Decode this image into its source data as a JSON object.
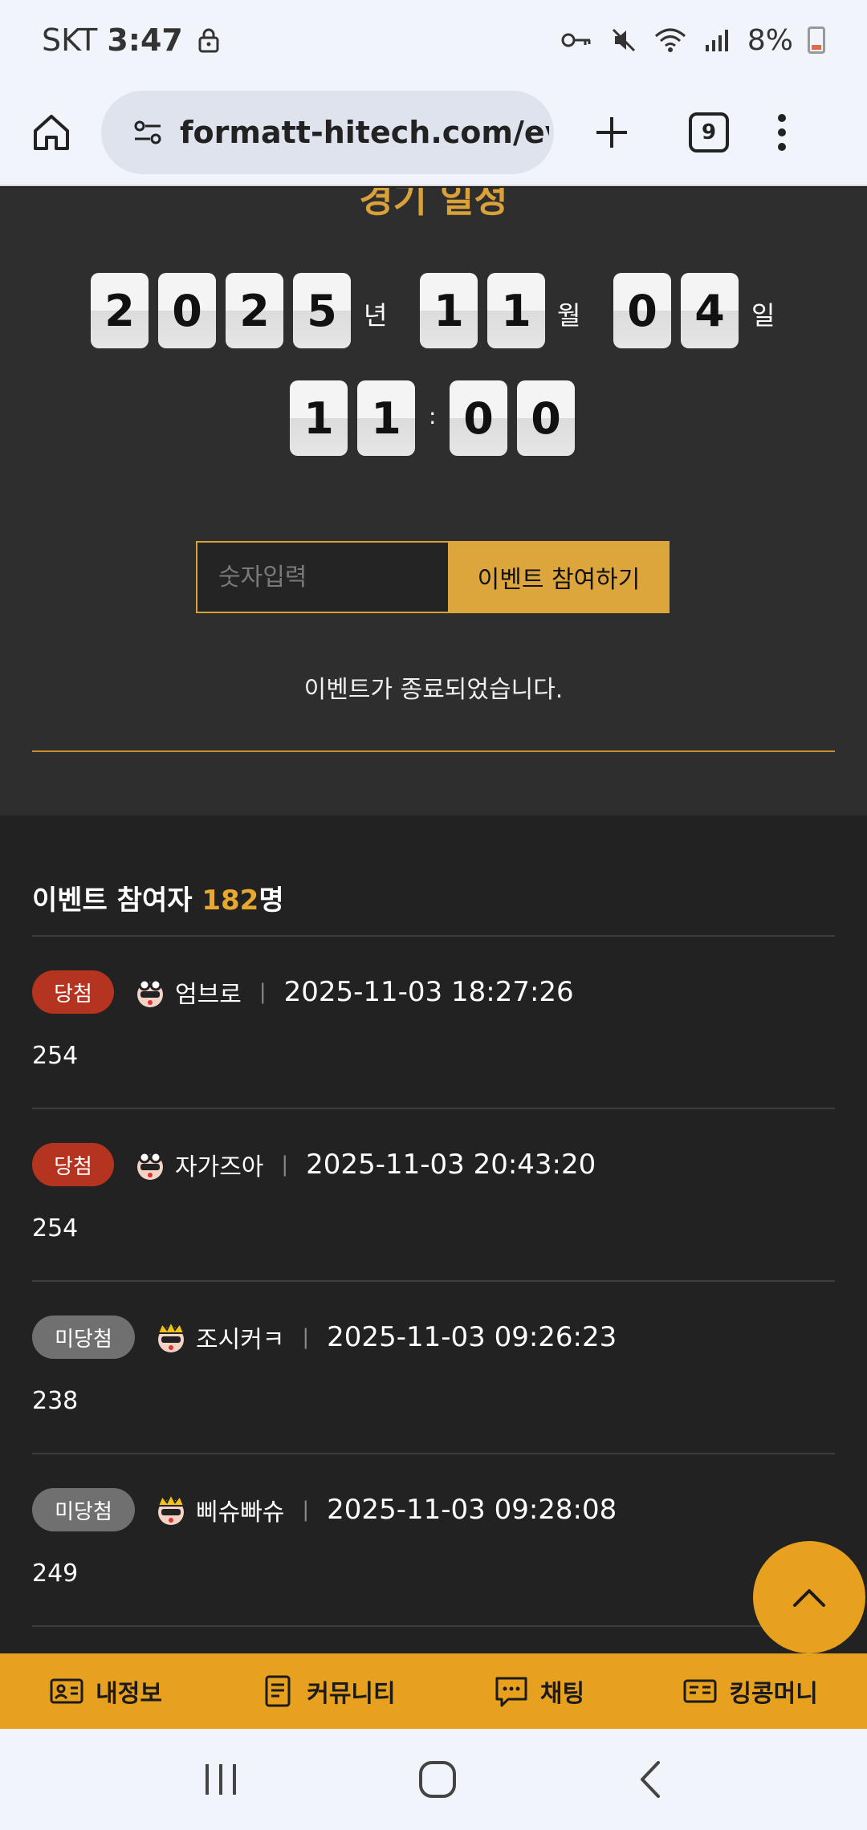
{
  "status_bar": {
    "carrier": "SKT",
    "time": "3:47",
    "battery": "8%",
    "icons": [
      "lock-icon",
      "vpn-key-icon",
      "mute-icon",
      "wifi-icon",
      "signal-icon",
      "battery-icon"
    ]
  },
  "browser": {
    "url": "formatt-hitech.com/even",
    "tab_count": "9"
  },
  "schedule": {
    "title": "경기 일정",
    "year_digits": [
      "2",
      "0",
      "2",
      "5"
    ],
    "year_unit": "년",
    "month_digits": [
      "1",
      "1"
    ],
    "month_unit": "월",
    "day_digits": [
      "0",
      "4"
    ],
    "day_unit": "일",
    "hour_digits": [
      "1",
      "1"
    ],
    "colon": ":",
    "minute_digits": [
      "0",
      "0"
    ],
    "input_placeholder": "숫자입력",
    "join_button": "이벤트 참여하기",
    "status_message": "이벤트가 종료되었습니다."
  },
  "participants": {
    "heading_prefix": "이벤트 참여자 ",
    "count": "182",
    "heading_suffix": "명",
    "entries": [
      {
        "result": "당첨",
        "nickname": "엄브로",
        "timestamp": "2025-11-03 18:27:26",
        "value": "254"
      },
      {
        "result": "당첨",
        "nickname": "자가즈아",
        "timestamp": "2025-11-03 20:43:20",
        "value": "254"
      },
      {
        "result": "미당첨",
        "nickname": "조시커ㅋ",
        "timestamp": "2025-11-03 09:26:23",
        "value": "238"
      },
      {
        "result": "미당첨",
        "nickname": "삐슈빠슈",
        "timestamp": "2025-11-03 09:28:08",
        "value": "249"
      }
    ],
    "separator": "|"
  },
  "bottom_nav": {
    "items": [
      {
        "label": "내정보",
        "icon": "profile-card-icon"
      },
      {
        "label": "커뮤니티",
        "icon": "document-icon"
      },
      {
        "label": "채팅",
        "icon": "chat-icon"
      },
      {
        "label": "킹콩머니",
        "icon": "money-card-icon"
      }
    ]
  },
  "colors": {
    "accent": "#e8a11e",
    "win_badge": "#b5341f",
    "lose_badge": "#707070",
    "panel": "#2e2e2e"
  }
}
